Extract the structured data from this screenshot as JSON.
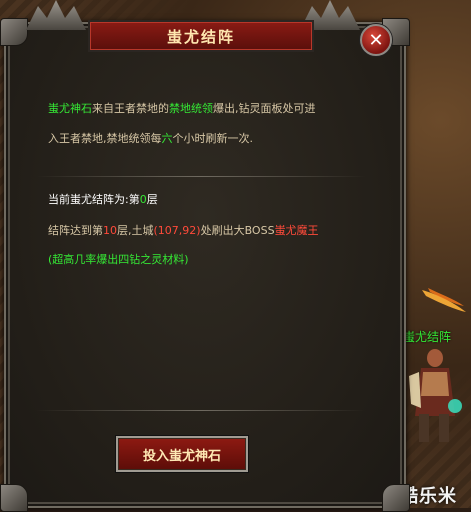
{
  "dialog": {
    "title": "蚩尤结阵",
    "close_glyph": "✕",
    "description": {
      "part1_green": "蚩尤神石",
      "part2": "来自王者禁地的",
      "part3_green": "禁地统领",
      "part4": "爆出,钻灵面板处可进",
      "line2_part1": "入王者禁地,禁地统领每",
      "line2_green": "六",
      "line2_part2": "个小时刷新一次."
    },
    "status": {
      "label": "当前蚩尤结阵为:第",
      "level": "0",
      "suffix": "层"
    },
    "reward": {
      "part1": "结阵达到第",
      "level": "10",
      "part2": "层,土城",
      "coords": "(107,92)",
      "part3": "处刷出大BOSS",
      "boss": "蚩尤魔王"
    },
    "note": "(超高几率爆出四钻之灵材料)",
    "action_button": "投入蚩尤神石"
  },
  "npc": {
    "name": "蚩尤结阵"
  },
  "watermark": "酷乐米",
  "colors": {
    "highlight_green": "#35e835",
    "highlight_red": "#ff4a3a",
    "panel_bg": "#221e18",
    "button_red": "#8e1a12"
  }
}
